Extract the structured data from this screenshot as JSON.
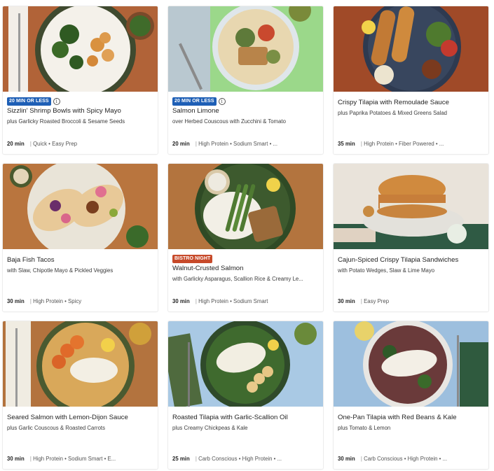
{
  "recipes": [
    {
      "badge": "20 MIN OR LESS",
      "title": "Sizzlin' Shrimp Bowls with Spicy Mayo",
      "subtitle": "plus Garlicky Roasted Broccoli & Sesame Seeds",
      "time": "20 min",
      "tags": "Quick • Easy Prep"
    },
    {
      "badge": "20 MIN OR LESS",
      "title": "Salmon Limone",
      "subtitle": "over Herbed Couscous with Zucchini & Tomato",
      "time": "20 min",
      "tags": "High Protein • Sodium Smart • ..."
    },
    {
      "badge": "",
      "title": "Crispy Tilapia with Remoulade Sauce",
      "subtitle": "plus Paprika Potatoes & Mixed Greens Salad",
      "time": "35 min",
      "tags": "High Protein • Fiber Powered • ..."
    },
    {
      "badge": "",
      "title": "Baja Fish Tacos",
      "subtitle": "with Slaw, Chipotle Mayo & Pickled Veggies",
      "time": "30 min",
      "tags": "High Protein • Spicy"
    },
    {
      "badge": "BISTRO NIGHT",
      "title": "Walnut-Crusted Salmon",
      "subtitle": "with Garlicky Asparagus, Scallion Rice & Creamy Le...",
      "time": "30 min",
      "tags": "High Protein • Sodium Smart"
    },
    {
      "badge": "",
      "title": "Cajun-Spiced Crispy Tilapia Sandwiches",
      "subtitle": "with Potato Wedges, Slaw & Lime Mayo",
      "time": "30 min",
      "tags": "Easy Prep"
    },
    {
      "badge": "",
      "title": "Seared Salmon with Lemon-Dijon Sauce",
      "subtitle": "plus Garlic Couscous & Roasted Carrots",
      "time": "30 min",
      "tags": "High Protein • Sodium Smart • E..."
    },
    {
      "badge": "",
      "title": "Roasted Tilapia with Garlic-Scallion Oil",
      "subtitle": "plus Creamy Chickpeas & Kale",
      "time": "25 min",
      "tags": "Carb Conscious • High Protein • ..."
    },
    {
      "badge": "",
      "title": "One-Pan Tilapia with Red Beans & Kale",
      "subtitle": "plus Tomato & Lemon",
      "time": "30 min",
      "tags": "Carb Conscious • High Protein • ..."
    }
  ],
  "colors": {
    "badge_quick": "#1e5fb6",
    "badge_bistro": "#c74a2a"
  }
}
